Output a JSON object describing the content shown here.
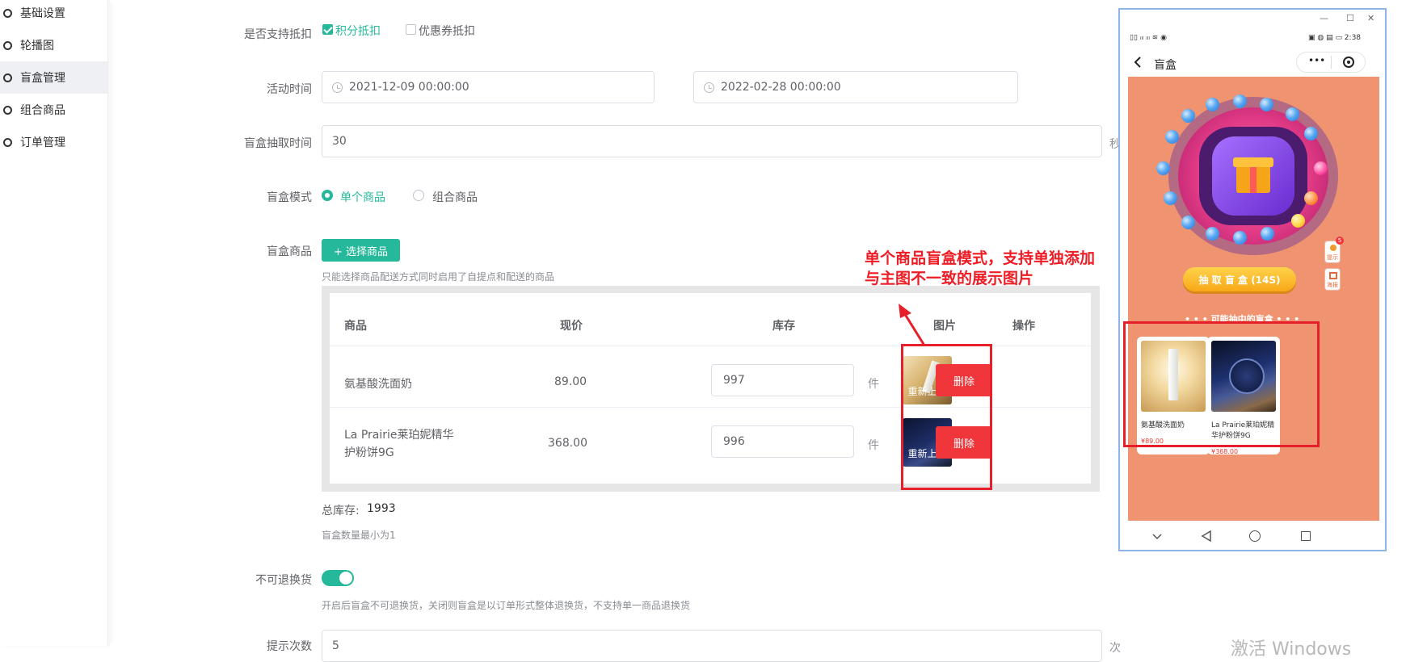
{
  "sidebar": {
    "items": [
      {
        "label": "基础设置"
      },
      {
        "label": "轮播图"
      },
      {
        "label": "盲盒管理"
      },
      {
        "label": "组合商品"
      },
      {
        "label": "订单管理"
      }
    ]
  },
  "form": {
    "deduction": {
      "label": "是否支持抵扣",
      "opt_points": "积分抵扣",
      "opt_coupon": "优惠券抵扣"
    },
    "activity_time": {
      "label": "活动时间",
      "start": "2021-12-09 00:00:00",
      "end": "2022-02-28 00:00:00"
    },
    "draw_time": {
      "label": "盲盒抽取时间",
      "value": "30",
      "unit": "秒"
    },
    "mode": {
      "label": "盲盒模式",
      "opt_single": "单个商品",
      "opt_combo": "组合商品"
    },
    "goods": {
      "label": "盲盒商品",
      "select_button": "+ 选择商品",
      "hint": "只能选择商品配送方式同时启用了自提点和配送的商品",
      "columns": [
        "商品",
        "现价",
        "库存",
        "图片",
        "操作"
      ],
      "rows": [
        {
          "name": "氨基酸洗面奶",
          "name_line2": "",
          "price": "89.00",
          "stock": "997",
          "unit": "件",
          "upload": "重新上传",
          "delete": "删除"
        },
        {
          "name": "La Prairie莱珀妮精华",
          "name_line2": "护粉饼9G",
          "price": "368.00",
          "stock": "996",
          "unit": "件",
          "upload": "重新上传",
          "delete": "删除"
        }
      ],
      "total_stock_label": "总库存:",
      "total_stock_value": "1993",
      "min_hint": "盲盒数量最小为1"
    },
    "no_return": {
      "label": "不可退换货",
      "enabled": true,
      "hint": "开启后盲盒不可退换货，关闭则盲盒是以订单形式整体退换货，不支持单一商品退换货"
    },
    "hint_count": {
      "label": "提示次数",
      "value": "5",
      "unit": "次"
    }
  },
  "annotation": {
    "line1": "单个商品盲盒模式，支持单独添加",
    "line2": "与主图不一致的展示图片",
    "color": "#ee1c25"
  },
  "phone": {
    "window_controls": [
      "—",
      "☐",
      "✕"
    ],
    "status_left": "▯▯ ᵢₗₗ ᵢₗₗ ≋ ◉",
    "status_right": "▣ ◍ ▤ ▭ 2:38",
    "title": "盲盒",
    "menu_dots": "•••",
    "draw_button": "抽 取 盲 盒 (14S)",
    "possible_title": "• • • 可能抽中的盲盒 • • •",
    "side_buttons": [
      {
        "label": "提示",
        "badge": "5"
      },
      {
        "label": "海报"
      }
    ],
    "cards": [
      {
        "name": "氨基酸洗面奶",
        "price": "¥89.00"
      },
      {
        "name": "La Prairie莱珀妮精华护粉饼9G",
        "price": "¥368.00"
      }
    ]
  },
  "watermark": "激活 Windows",
  "colors": {
    "primary": "#26b89a",
    "danger": "#f0363b",
    "phone_bg": "#ef9370"
  }
}
